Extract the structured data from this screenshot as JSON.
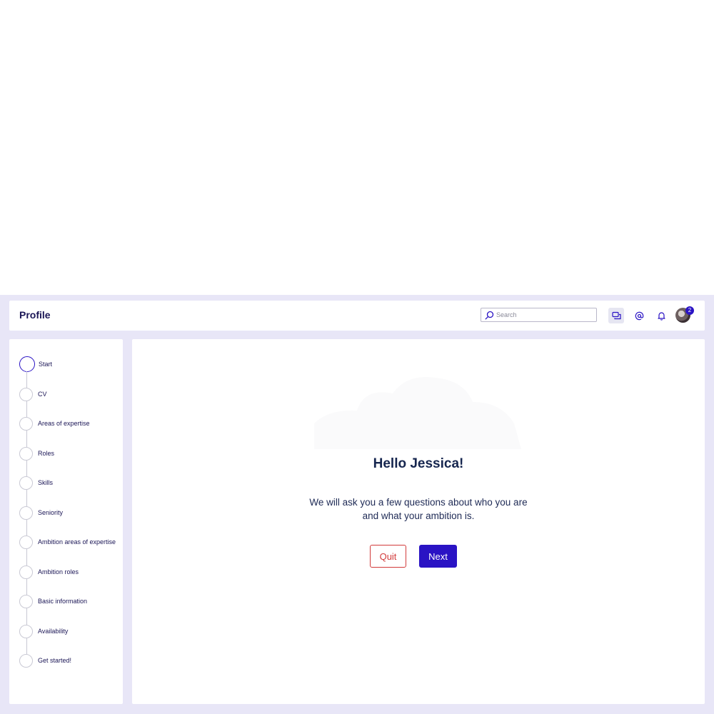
{
  "header": {
    "title": "Profile",
    "search_placeholder": "Search",
    "notification_count": "2",
    "icons": [
      "search-icon",
      "chat-icon",
      "mention-icon",
      "bell-icon",
      "avatar"
    ]
  },
  "steps": [
    {
      "label": "Start",
      "active": true
    },
    {
      "label": "CV",
      "active": false
    },
    {
      "label": "Areas of expertise",
      "active": false
    },
    {
      "label": "Roles",
      "active": false
    },
    {
      "label": "Skills",
      "active": false
    },
    {
      "label": "Seniority",
      "active": false
    },
    {
      "label": "Ambition areas of expertise",
      "active": false
    },
    {
      "label": "Ambition roles",
      "active": false
    },
    {
      "label": "Basic information",
      "active": false
    },
    {
      "label": "Availability",
      "active": false
    },
    {
      "label": "Get started!",
      "active": false
    }
  ],
  "main": {
    "greeting": "Hello Jessica!",
    "intro_line1": "We will ask you a few questions about who you are",
    "intro_line2": "and what your ambition is.",
    "quit_label": "Quit",
    "next_label": "Next"
  },
  "colors": {
    "accent": "#2a13c4",
    "danger": "#d23a3a",
    "frame": "#e8e6f7",
    "heading": "#16264f"
  }
}
